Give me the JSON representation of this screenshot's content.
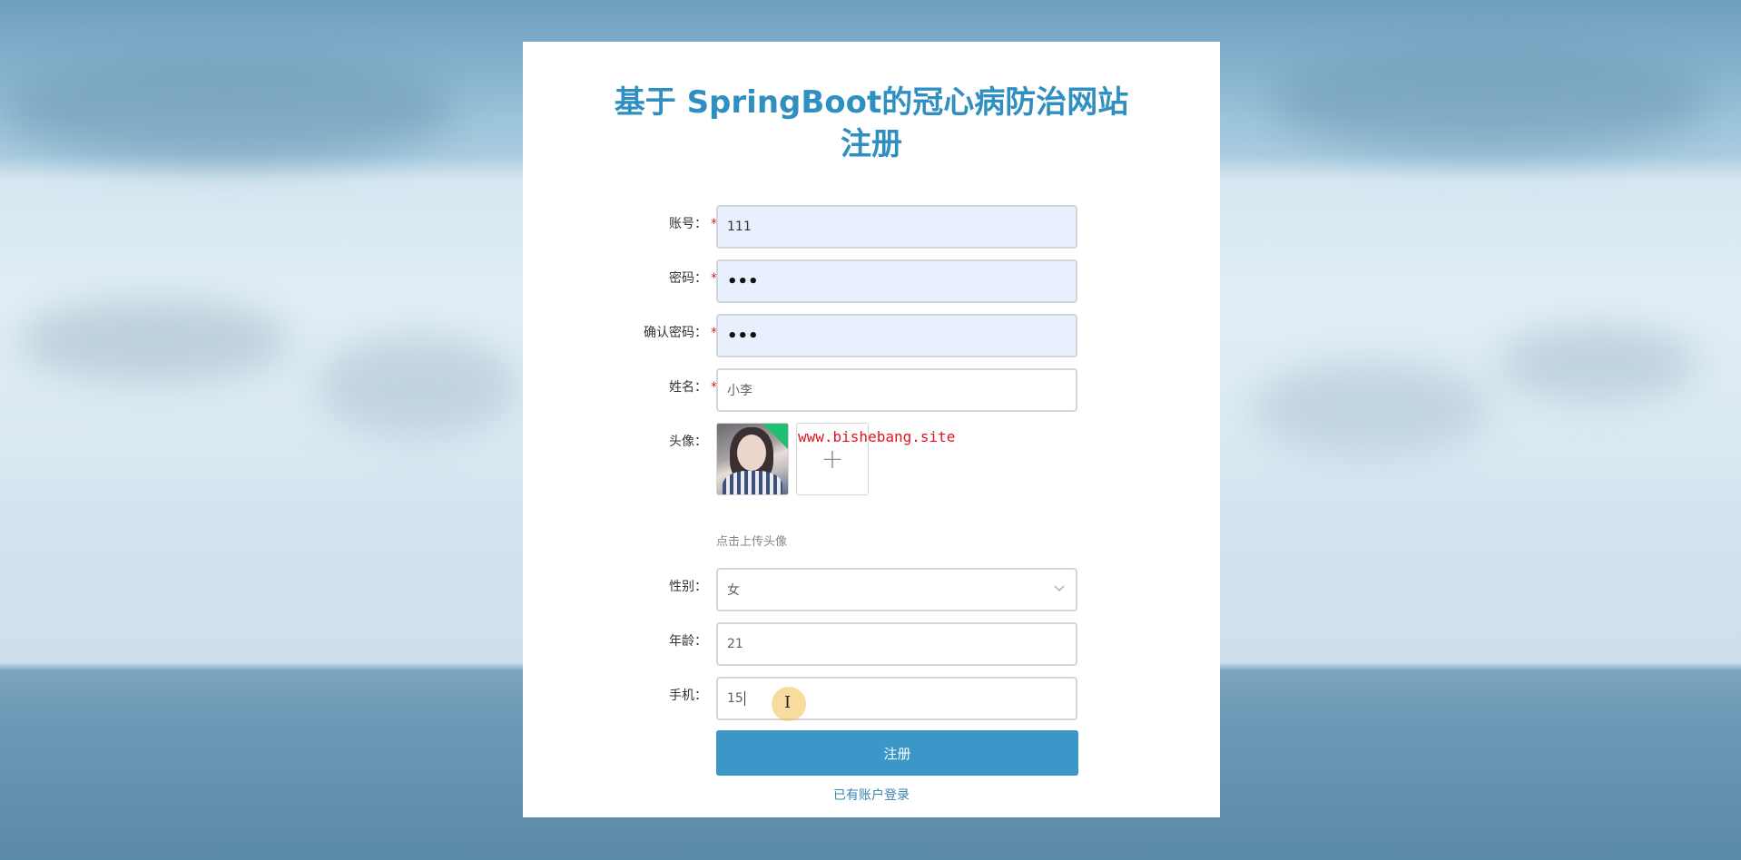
{
  "page": {
    "title_line1": "基于 SpringBoot的冠心病防治网站",
    "title_line2": "注册"
  },
  "form": {
    "account": {
      "label": "账号：",
      "required": "*",
      "value": "111"
    },
    "password": {
      "label": "密码：",
      "required": "*",
      "value": "•••"
    },
    "confirm_password": {
      "label": "确认密码：",
      "required": "*",
      "value": "•••"
    },
    "name": {
      "label": "姓名：",
      "required": "*",
      "value": "小李"
    },
    "avatar": {
      "label": "头像：",
      "upload_icon": "+",
      "hint": "点击上传头像",
      "watermark": "www.bishebang.site"
    },
    "gender": {
      "label": "性别：",
      "value": "女",
      "chevron_icon": "chevron-down-icon"
    },
    "age": {
      "label": "年龄：",
      "value": "21"
    },
    "phone": {
      "label": "手机：",
      "value": "15"
    }
  },
  "actions": {
    "submit_label": "注册",
    "login_link": "已有账户登录"
  },
  "colors": {
    "title": "#2f8fc1",
    "button": "#3a97c7",
    "required": "#e02020",
    "filled_input_bg": "#e8f0fe"
  }
}
